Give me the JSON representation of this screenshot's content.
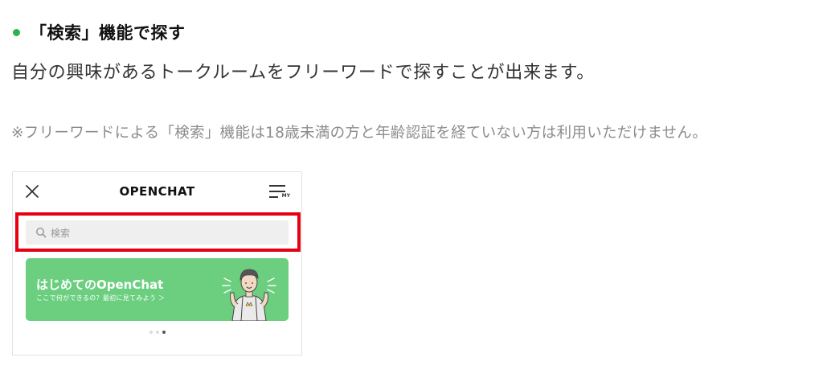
{
  "section": {
    "heading": "「検索」機能で探す",
    "description": "自分の興味があるトークルームをフリーワードで探すことが出来ます。",
    "note": "※フリーワードによる「検索」機能は18歳未満の方と年齢認証を経ていない方は利用いただけません。"
  },
  "app": {
    "title": "OPENCHAT",
    "menu_badge": "MY",
    "search": {
      "placeholder": "検索"
    },
    "banner": {
      "title": "はじめてのOpenChat",
      "subtitle": "ここで何ができるの？最初に見てみよう ＞"
    },
    "carousel": {
      "pages": 3,
      "active_index": 2
    }
  },
  "colors": {
    "bullet": "#2db34a",
    "highlight_border": "#e60012",
    "banner_bg": "#6bcf7f"
  },
  "icons": [
    "close-icon",
    "menu-icon",
    "search-icon"
  ]
}
